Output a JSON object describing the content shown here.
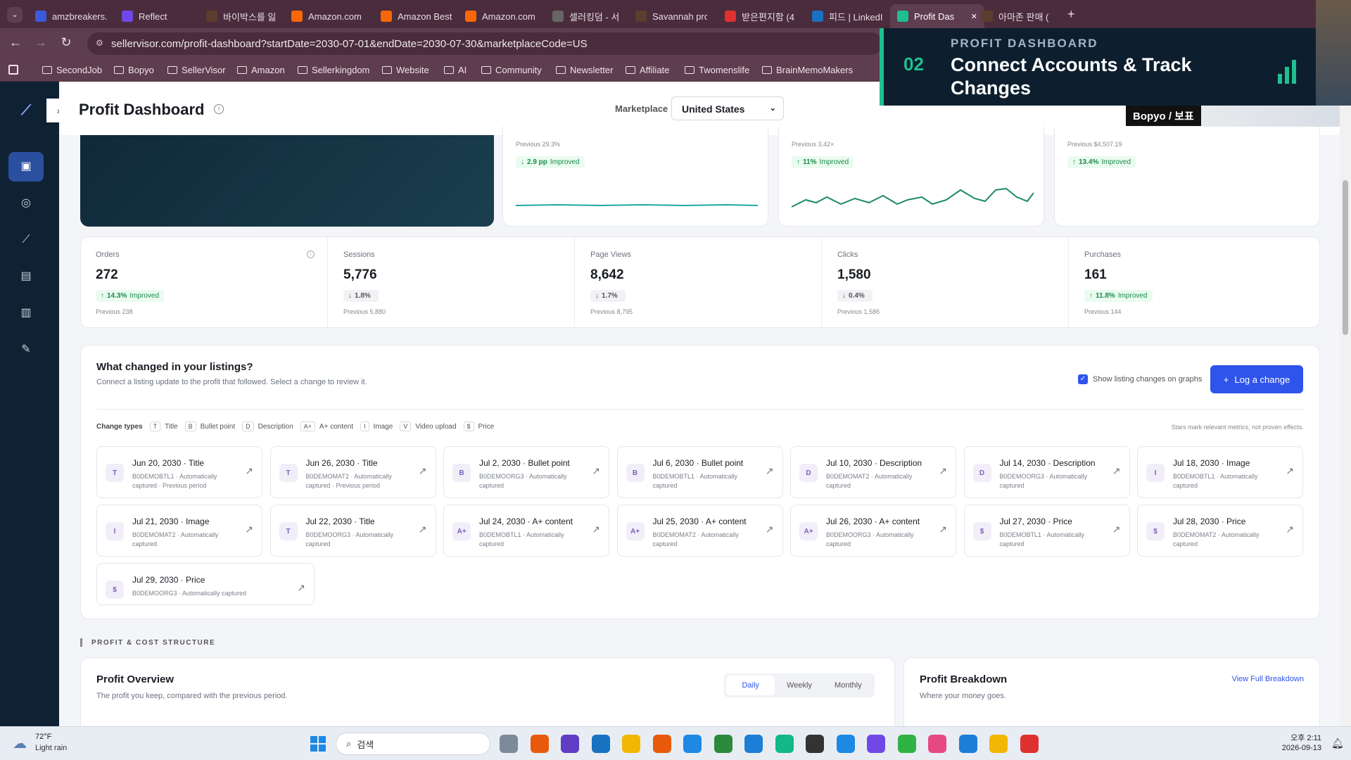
{
  "browser": {
    "tabs": [
      {
        "label": "amzbreakers.c",
        "color": "#3b5bdb"
      },
      {
        "label": "Reflect",
        "color": "#7048e8"
      },
      {
        "label": "바이박스를 잃",
        "color": "#5c3d2e"
      },
      {
        "label": "Amazon.com",
        "color": "#f76707"
      },
      {
        "label": "Amazon Best",
        "color": "#f76707"
      },
      {
        "label": "Amazon.com",
        "color": "#f76707"
      },
      {
        "label": "셀러킹덤 - 서",
        "color": "#666"
      },
      {
        "label": "Savannah pro",
        "color": "#5c3d2e"
      },
      {
        "label": "받은편지함 (4",
        "color": "#e03131"
      },
      {
        "label": "피드 | LinkedI",
        "color": "#1971c2"
      },
      {
        "label": "Profit Das",
        "color": "#1fbf8f"
      },
      {
        "label": "아마존 판매 (",
        "color": "#5c3d2e"
      }
    ],
    "url": "sellervisor.com/profit-dashboard?startDate=2030-07-01&endDate=2030-07-30&marketplaceCode=US",
    "bookmarks": [
      "SecondJob",
      "Bopyo",
      "SellerVisor",
      "Amazon",
      "Sellerkingdom",
      "Website",
      "AI",
      "Community",
      "Newsletter",
      "Affiliate",
      "Twomenslife",
      "BrainMemoMakers"
    ]
  },
  "overlay": {
    "number": "02",
    "kicker": "PROFIT DASHBOARD",
    "title": "Connect Accounts & Track Changes",
    "presenter": "Bopyo / 보표"
  },
  "header": {
    "title": "Profit Dashboard",
    "marketplace_label": "Marketplace",
    "marketplace_value": "United States"
  },
  "top_cards": [
    {
      "previous": "Previous 29.3%",
      "delta": "2.9 pp",
      "status": "Improved",
      "dir": "down"
    },
    {
      "previous": "Previous 3.42×",
      "delta": "11%",
      "status": "Improved",
      "dir": "up"
    },
    {
      "previous": "Previous $4,507.19",
      "delta": "13.4%",
      "status": "Improved",
      "dir": "up"
    }
  ],
  "metrics": [
    {
      "label": "Orders",
      "value": "272",
      "delta": "14.3%",
      "status": "Improved",
      "dir": "up",
      "previous": "Previous 238"
    },
    {
      "label": "Sessions",
      "value": "5,776",
      "delta": "1.8%",
      "status": "",
      "dir": "down",
      "previous": "Previous 5,880"
    },
    {
      "label": "Page Views",
      "value": "8,642",
      "delta": "1.7%",
      "status": "",
      "dir": "down",
      "previous": "Previous 8,795"
    },
    {
      "label": "Clicks",
      "value": "1,580",
      "delta": "0.4%",
      "status": "",
      "dir": "down",
      "previous": "Previous 1,586"
    },
    {
      "label": "Purchases",
      "value": "161",
      "delta": "11.8%",
      "status": "Improved",
      "dir": "up",
      "previous": "Previous 144"
    }
  ],
  "changes": {
    "title": "What changed in your listings?",
    "subtitle": "Connect a listing update to the profit that followed. Select a change to review it.",
    "toggle_label": "Show listing changes on graphs",
    "log_button": "Log a change",
    "types_label": "Change types",
    "types": [
      {
        "b": "T",
        "l": "Title"
      },
      {
        "b": "B",
        "l": "Bullet point"
      },
      {
        "b": "D",
        "l": "Description"
      },
      {
        "b": "A+",
        "l": "A+ content"
      },
      {
        "b": "I",
        "l": "Image"
      },
      {
        "b": "V",
        "l": "Video upload"
      },
      {
        "b": "$",
        "l": "Price"
      }
    ],
    "note": "Stars mark relevant metrics, not proven effects.",
    "items": [
      {
        "b": "T",
        "t": "Jun 20, 2030 · Title",
        "s": "B0DEMOBTL1 · Automatically captured · Previous period"
      },
      {
        "b": "T",
        "t": "Jun 26, 2030 · Title",
        "s": "B0DEMOMAT2 · Automatically captured · Previous period"
      },
      {
        "b": "B",
        "t": "Jul 2, 2030 · Bullet point",
        "s": "B0DEMOORG3 · Automatically captured"
      },
      {
        "b": "B",
        "t": "Jul 6, 2030 · Bullet point",
        "s": "B0DEMOBTL1 · Automatically captured"
      },
      {
        "b": "D",
        "t": "Jul 10, 2030 · Description",
        "s": "B0DEMOMAT2 · Automatically captured"
      },
      {
        "b": "D",
        "t": "Jul 14, 2030 · Description",
        "s": "B0DEMOORG3 · Automatically captured"
      },
      {
        "b": "I",
        "t": "Jul 18, 2030 · Image",
        "s": "B0DEMOBTL1 · Automatically captured"
      },
      {
        "b": "I",
        "t": "Jul 21, 2030 · Image",
        "s": "B0DEMOMAT2 · Automatically captured"
      },
      {
        "b": "T",
        "t": "Jul 22, 2030 · Title",
        "s": "B0DEMOORG3 · Automatically captured"
      },
      {
        "b": "A+",
        "t": "Jul 24, 2030 · A+ content",
        "s": "B0DEMOBTL1 · Automatically captured"
      },
      {
        "b": "A+",
        "t": "Jul 25, 2030 · A+ content",
        "s": "B0DEMOMAT2 · Automatically captured"
      },
      {
        "b": "A+",
        "t": "Jul 26, 2030 · A+ content",
        "s": "B0DEMOORG3 · Automatically captured"
      },
      {
        "b": "$",
        "t": "Jul 27, 2030 · Price",
        "s": "B0DEMOBTL1 · Automatically captured"
      },
      {
        "b": "$",
        "t": "Jul 28, 2030 · Price",
        "s": "B0DEMOMAT2 · Automatically captured"
      },
      {
        "b": "$",
        "t": "Jul 29, 2030 · Price",
        "s": "B0DEMOORG3 · Automatically captured"
      }
    ]
  },
  "section_label": "PROFIT & COST STRUCTURE",
  "profit_overview": {
    "title": "Profit Overview",
    "subtitle": "The profit you keep, compared with the previous period.",
    "tabs": [
      "Daily",
      "Weekly",
      "Monthly"
    ]
  },
  "profit_breakdown": {
    "title": "Profit Breakdown",
    "subtitle": "Where your money goes.",
    "link": "View Full Breakdown"
  },
  "taskbar": {
    "weather_temp": "72°F",
    "weather_desc": "Light rain",
    "search": "검색",
    "time": "오후 2:11",
    "date": "2026-09-13"
  },
  "colors": {
    "accent": "#2f54eb",
    "sidebar": "#0f2233",
    "improved": "#1b8a4a",
    "overlay_accent": "#1fbf8f"
  }
}
